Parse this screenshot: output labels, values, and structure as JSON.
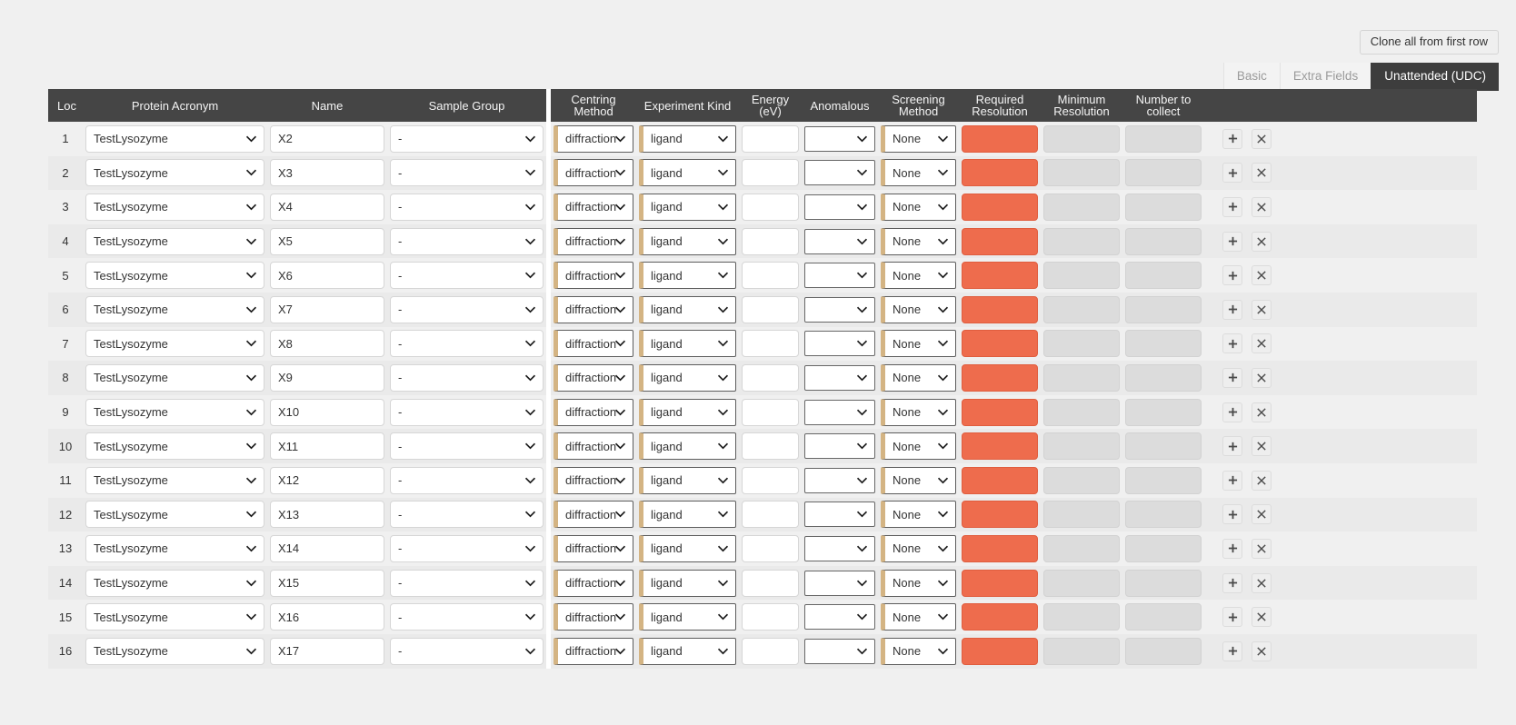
{
  "toolbar": {
    "clone_label": "Clone all from first row"
  },
  "tabs": [
    {
      "label": "Basic",
      "active": false
    },
    {
      "label": "Extra Fields",
      "active": false
    },
    {
      "label": "Unattended (UDC)",
      "active": true
    }
  ],
  "columns": [
    {
      "key": "loc",
      "label": "Loc"
    },
    {
      "key": "prot",
      "label": "Protein Acronym"
    },
    {
      "key": "name",
      "label": "Name"
    },
    {
      "key": "sgrp",
      "label": "Sample Group"
    },
    {
      "key": "cm",
      "label": "Centring Method"
    },
    {
      "key": "ek",
      "label": "Experiment Kind"
    },
    {
      "key": "en",
      "label": "Energy (eV)"
    },
    {
      "key": "anom",
      "label": "Anomalous"
    },
    {
      "key": "scr",
      "label": "Screening Method"
    },
    {
      "key": "rres",
      "label": "Required Resolution"
    },
    {
      "key": "mres",
      "label": "Minimum Resolution"
    },
    {
      "key": "ntc",
      "label": "Number to collect"
    }
  ],
  "colors": {
    "header_bg": "#454545",
    "tab_active_bg": "#3d3d3d",
    "accent_tan": "#d4b483",
    "error_red": "#ee6c4d",
    "disabled_gray": "#dcdcdc",
    "page_bg": "#f0f0f0"
  },
  "row_actions": {
    "add_label": "+",
    "remove_label": "✖"
  },
  "rows": [
    {
      "loc": "1",
      "prot": "TestLysozyme",
      "name": "X2",
      "sgrp": "-",
      "cm": "diffraction",
      "ek": "ligand",
      "en": "",
      "anom": "",
      "scr": "None",
      "rres": "",
      "mres": "",
      "ntc": ""
    },
    {
      "loc": "2",
      "prot": "TestLysozyme",
      "name": "X3",
      "sgrp": "-",
      "cm": "diffraction",
      "ek": "ligand",
      "en": "",
      "anom": "",
      "scr": "None",
      "rres": "",
      "mres": "",
      "ntc": ""
    },
    {
      "loc": "3",
      "prot": "TestLysozyme",
      "name": "X4",
      "sgrp": "-",
      "cm": "diffraction",
      "ek": "ligand",
      "en": "",
      "anom": "",
      "scr": "None",
      "rres": "",
      "mres": "",
      "ntc": ""
    },
    {
      "loc": "4",
      "prot": "TestLysozyme",
      "name": "X5",
      "sgrp": "-",
      "cm": "diffraction",
      "ek": "ligand",
      "en": "",
      "anom": "",
      "scr": "None",
      "rres": "",
      "mres": "",
      "ntc": ""
    },
    {
      "loc": "5",
      "prot": "TestLysozyme",
      "name": "X6",
      "sgrp": "-",
      "cm": "diffraction",
      "ek": "ligand",
      "en": "",
      "anom": "",
      "scr": "None",
      "rres": "",
      "mres": "",
      "ntc": ""
    },
    {
      "loc": "6",
      "prot": "TestLysozyme",
      "name": "X7",
      "sgrp": "-",
      "cm": "diffraction",
      "ek": "ligand",
      "en": "",
      "anom": "",
      "scr": "None",
      "rres": "",
      "mres": "",
      "ntc": ""
    },
    {
      "loc": "7",
      "prot": "TestLysozyme",
      "name": "X8",
      "sgrp": "-",
      "cm": "diffraction",
      "ek": "ligand",
      "en": "",
      "anom": "",
      "scr": "None",
      "rres": "",
      "mres": "",
      "ntc": ""
    },
    {
      "loc": "8",
      "prot": "TestLysozyme",
      "name": "X9",
      "sgrp": "-",
      "cm": "diffraction",
      "ek": "ligand",
      "en": "",
      "anom": "",
      "scr": "None",
      "rres": "",
      "mres": "",
      "ntc": ""
    },
    {
      "loc": "9",
      "prot": "TestLysozyme",
      "name": "X10",
      "sgrp": "-",
      "cm": "diffraction",
      "ek": "ligand",
      "en": "",
      "anom": "",
      "scr": "None",
      "rres": "",
      "mres": "",
      "ntc": ""
    },
    {
      "loc": "10",
      "prot": "TestLysozyme",
      "name": "X11",
      "sgrp": "-",
      "cm": "diffraction",
      "ek": "ligand",
      "en": "",
      "anom": "",
      "scr": "None",
      "rres": "",
      "mres": "",
      "ntc": ""
    },
    {
      "loc": "11",
      "prot": "TestLysozyme",
      "name": "X12",
      "sgrp": "-",
      "cm": "diffraction",
      "ek": "ligand",
      "en": "",
      "anom": "",
      "scr": "None",
      "rres": "",
      "mres": "",
      "ntc": ""
    },
    {
      "loc": "12",
      "prot": "TestLysozyme",
      "name": "X13",
      "sgrp": "-",
      "cm": "diffraction",
      "ek": "ligand",
      "en": "",
      "anom": "",
      "scr": "None",
      "rres": "",
      "mres": "",
      "ntc": ""
    },
    {
      "loc": "13",
      "prot": "TestLysozyme",
      "name": "X14",
      "sgrp": "-",
      "cm": "diffraction",
      "ek": "ligand",
      "en": "",
      "anom": "",
      "scr": "None",
      "rres": "",
      "mres": "",
      "ntc": ""
    },
    {
      "loc": "14",
      "prot": "TestLysozyme",
      "name": "X15",
      "sgrp": "-",
      "cm": "diffraction",
      "ek": "ligand",
      "en": "",
      "anom": "",
      "scr": "None",
      "rres": "",
      "mres": "",
      "ntc": ""
    },
    {
      "loc": "15",
      "prot": "TestLysozyme",
      "name": "X16",
      "sgrp": "-",
      "cm": "diffraction",
      "ek": "ligand",
      "en": "",
      "anom": "",
      "scr": "None",
      "rres": "",
      "mres": "",
      "ntc": ""
    },
    {
      "loc": "16",
      "prot": "TestLysozyme",
      "name": "X17",
      "sgrp": "-",
      "cm": "diffraction",
      "ek": "ligand",
      "en": "",
      "anom": "",
      "scr": "None",
      "rres": "",
      "mres": "",
      "ntc": ""
    }
  ]
}
